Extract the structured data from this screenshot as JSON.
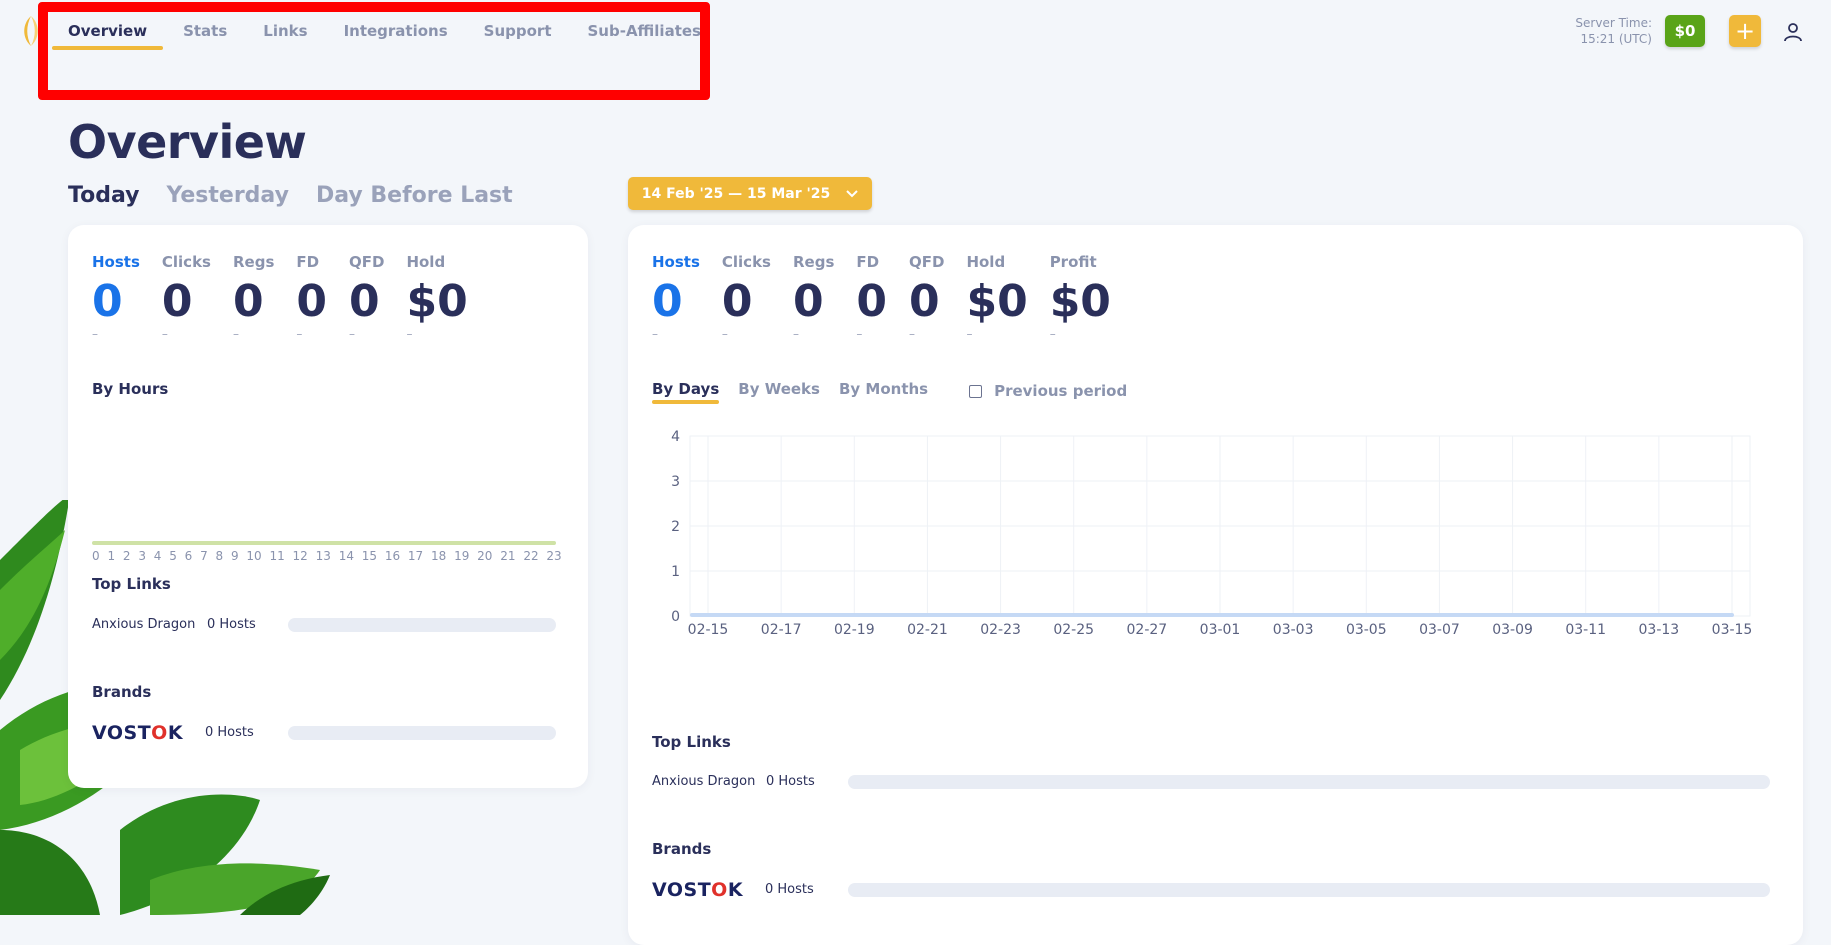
{
  "nav": {
    "items": [
      "Overview",
      "Stats",
      "Links",
      "Integrations",
      "Support",
      "Sub-Affiliates"
    ],
    "active": 0
  },
  "header": {
    "server_time_label": "Server Time:",
    "server_time_value": "15:21 (UTC)",
    "balance": "$0",
    "plus": "+"
  },
  "page": {
    "title": "Overview",
    "day_tabs": [
      "Today",
      "Yesterday",
      "Day Before Last"
    ],
    "date_range": "14 Feb '25 — 15 Mar '25"
  },
  "left_card": {
    "stats": [
      {
        "label": "Hosts",
        "value": "0",
        "dash": "–"
      },
      {
        "label": "Clicks",
        "value": "0",
        "dash": "–"
      },
      {
        "label": "Regs",
        "value": "0",
        "dash": "–"
      },
      {
        "label": "FD",
        "value": "0",
        "dash": "–"
      },
      {
        "label": "QFD",
        "value": "0",
        "dash": "–"
      },
      {
        "label": "Hold",
        "value": "$0",
        "dash": "–"
      }
    ],
    "by_hours_title": "By Hours",
    "hours": [
      "0",
      "1",
      "2",
      "3",
      "4",
      "5",
      "6",
      "7",
      "8",
      "9",
      "10",
      "11",
      "12",
      "13",
      "14",
      "15",
      "16",
      "17",
      "18",
      "19",
      "20",
      "21",
      "22",
      "23"
    ],
    "top_links_title": "Top Links",
    "top_link": {
      "name": "Anxious Dragon",
      "hosts": "0 Hosts"
    },
    "brands_title": "Brands",
    "brand": {
      "logo_a": "VOST",
      "logo_o": "O",
      "logo_b": "K",
      "hosts": "0 Hosts"
    }
  },
  "right_card": {
    "stats": [
      {
        "label": "Hosts",
        "value": "0",
        "dash": "–"
      },
      {
        "label": "Clicks",
        "value": "0",
        "dash": "–"
      },
      {
        "label": "Regs",
        "value": "0",
        "dash": "–"
      },
      {
        "label": "FD",
        "value": "0",
        "dash": "–"
      },
      {
        "label": "QFD",
        "value": "0",
        "dash": "–"
      },
      {
        "label": "Hold",
        "value": "$0",
        "dash": "–"
      },
      {
        "label": "Profit",
        "value": "$0",
        "dash": "–"
      }
    ],
    "period_tabs": [
      "By Days",
      "By Weeks",
      "By Months"
    ],
    "previous_period": "Previous period",
    "top_links_title": "Top Links",
    "top_link": {
      "name": "Anxious Dragon",
      "hosts": "0 Hosts"
    },
    "brands_title": "Brands",
    "brand": {
      "logo_a": "VOST",
      "logo_o": "O",
      "logo_b": "K",
      "hosts": "0 Hosts"
    }
  },
  "chart_data": {
    "type": "line",
    "title": "",
    "xlabel": "",
    "ylabel": "",
    "ylim": [
      0,
      4
    ],
    "yticks": [
      0,
      1,
      2,
      3,
      4
    ],
    "x": [
      "02-15",
      "02-17",
      "02-19",
      "02-21",
      "02-23",
      "02-25",
      "02-27",
      "03-01",
      "03-03",
      "03-05",
      "03-07",
      "03-09",
      "03-11",
      "03-13",
      "03-15"
    ],
    "series": [
      {
        "values": [
          0,
          0,
          0,
          0,
          0,
          0,
          0,
          0,
          0,
          0,
          0,
          0,
          0,
          0,
          0
        ]
      }
    ],
    "grid": true,
    "line_color": "#c5d9f5"
  },
  "colors": {
    "accent": "#f0b93a",
    "highlight": "#1a73e8",
    "balance": "#5aa418",
    "annotation_box": "#ff0000"
  }
}
